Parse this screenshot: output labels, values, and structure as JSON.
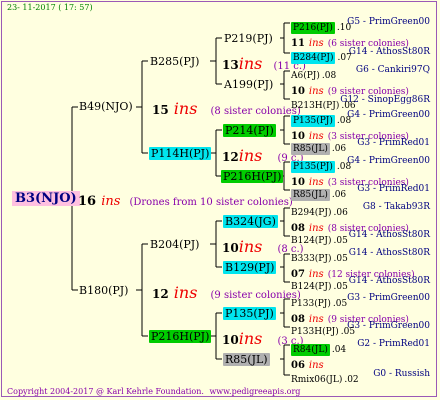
{
  "header": {
    "date": "23- 11-2017 ( 17: 57)"
  },
  "footer": {
    "copyright": "Copyright 2004-2017 @ Karl Kehrle Foundation.",
    "site": "www.pedigreeapis.org"
  },
  "colors": {
    "green": "#00cc00",
    "cyan": "#00e5ee",
    "grey": "#b0b0b0",
    "ins": "#ee0000",
    "sisters": "#8800aa",
    "ref": "#000080"
  },
  "root": {
    "label": "B3(NJO)",
    "year": "16",
    "ins": "ins",
    "note": "(Drones from 10 sister colonies)"
  },
  "gen1": {
    "b49": {
      "label": "B49(NJO)",
      "year": "15",
      "ins": "ins",
      "note": "(8 sister colonies)"
    },
    "b180": {
      "label": "B180(PJ)",
      "year": "12",
      "ins": "ins",
      "note": "(9 sister colonies)"
    }
  },
  "gen2": {
    "b285": {
      "label": "B285(PJ)",
      "year": "13",
      "ins": "ins",
      "note": "(11 c.)"
    },
    "p114h": {
      "label": "P114H(PJ)",
      "year": "12",
      "ins": "ins",
      "note": "(9 c.)"
    },
    "b204": {
      "label": "B204(PJ)",
      "year": "10",
      "ins": "ins",
      "note": "(8 c.)"
    },
    "p216h": {
      "label": "P216H(PJ)",
      "year": "10",
      "ins": "ins",
      "note": "(3 c.)"
    }
  },
  "gen3": {
    "p219": "P219(PJ)",
    "a199": "A199(PJ)",
    "p214": "P214(PJ)",
    "p216h": "P216H(PJ)",
    "b324": "B324(JG)",
    "b129": "B129(PJ)",
    "p135": "P135(PJ)",
    "r85": "R85(JL)"
  },
  "gen4": [
    {
      "label": "P216(PJ)",
      "suffix": ".10",
      "ref": "G5 - PrimGreen00"
    },
    {
      "label": "11",
      "ins": "ins",
      "sis": "(6 sister colonies)"
    },
    {
      "label": "B284(PJ)",
      "suffix": ".07",
      "ref": "G14 - AthosSt80R"
    },
    {
      "label": "A6(PJ)",
      "suffix": ".08",
      "ref": "G6 - Cankiri97Q"
    },
    {
      "label": "10",
      "ins": "ins",
      "sis": "(9 sister colonies)"
    },
    {
      "label": "B213H(PJ)",
      "suffix": ".06",
      "ref": "G12 - SinopEgg86R"
    },
    {
      "label": "P135(PJ)",
      "suffix": ".08",
      "ref": "G4 - PrimGreen00"
    },
    {
      "label": "10",
      "ins": "ins",
      "sis": "(3 sister colonies)"
    },
    {
      "label": "R85(JL)",
      "suffix": ".06",
      "ref": "G3 - PrimRed01"
    },
    {
      "label": "P135(PJ)",
      "suffix": ".08",
      "ref": "G4 - PrimGreen00"
    },
    {
      "label": "10",
      "ins": "ins",
      "sis": "(3 sister colonies)"
    },
    {
      "label": "R85(JL)",
      "suffix": ".06",
      "ref": "G3 - PrimRed01"
    },
    {
      "label": "B294(PJ)",
      "suffix": ".06",
      "ref": "G8 - Takab93R"
    },
    {
      "label": "08",
      "ins": "ins",
      "sis": "(8 sister colonies)"
    },
    {
      "label": "B124(PJ)",
      "suffix": ".05",
      "ref": "G14 - AthosSt80R"
    },
    {
      "label": "B333(PJ)",
      "suffix": ".05",
      "ref": "G14 - AthosSt80R"
    },
    {
      "label": "07",
      "ins": "ins",
      "sis": "(12 sister colonies)"
    },
    {
      "label": "B124(PJ)",
      "suffix": ".05",
      "ref": "G14 - AthosSt80R"
    },
    {
      "label": "P133(PJ)",
      "suffix": ".05",
      "ref": "G3 - PrimGreen00"
    },
    {
      "label": "08",
      "ins": "ins",
      "sis": "(9 sister colonies)"
    },
    {
      "label": "P133H(PJ)",
      "suffix": ".05",
      "ref": "G3 - PrimGreen00"
    },
    {
      "label": "R84(JL)",
      "suffix": ".04",
      "ref": "G2 - PrimRed01"
    },
    {
      "label": "06",
      "ins": "ins",
      "sis": ""
    },
    {
      "label": "Rmix06(JL)",
      "suffix": ".02",
      "ref": "G0 - Russish"
    }
  ]
}
